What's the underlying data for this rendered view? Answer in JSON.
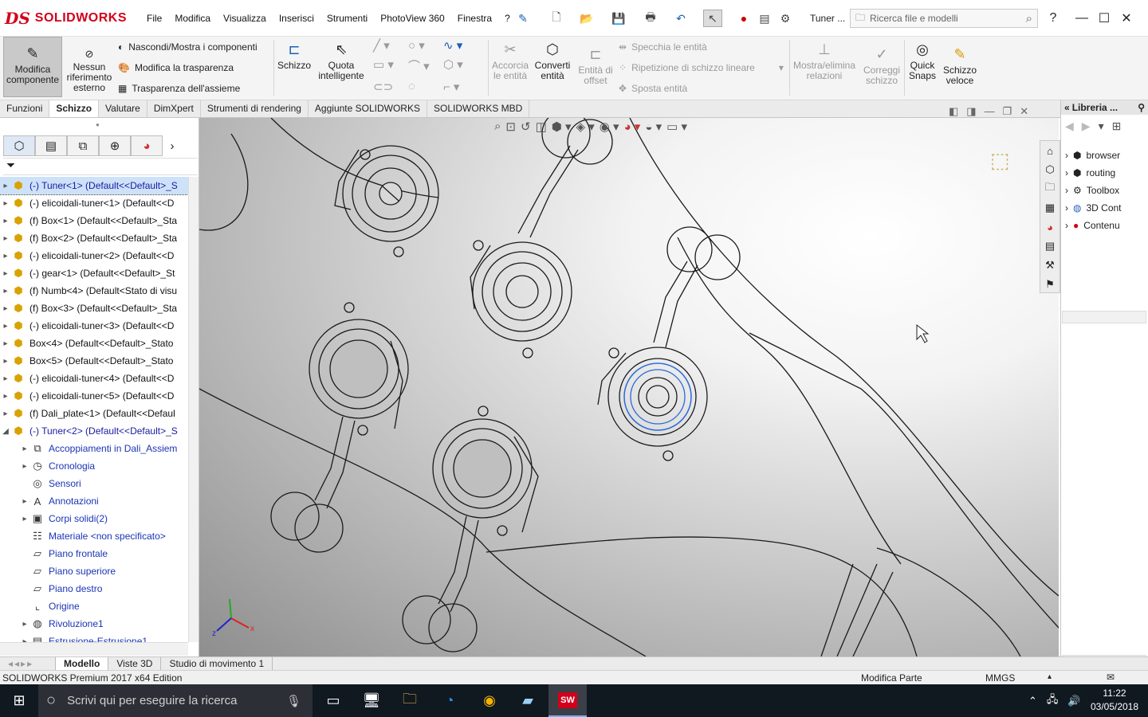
{
  "app": {
    "logo_prefix": "DS",
    "logo_text": "SOLIDWORKS",
    "document_name": "Tuner ...",
    "search_placeholder": "Ricerca file e modelli",
    "help_label": "?"
  },
  "menu": [
    "File",
    "Modifica",
    "Visualizza",
    "Inserisci",
    "Strumenti",
    "PhotoView 360",
    "Finestra",
    "?"
  ],
  "ribbon": {
    "modifica_componente": "Modifica componente",
    "nessun_riferimento": "Nessun riferimento esterno",
    "nascondi_mostra": "Nascondi/Mostra i componenti",
    "modifica_trasparenza": "Modifica la trasparenza",
    "trasparenza_assieme": "Trasparenza dell'assieme",
    "schizzo": "Schizzo",
    "quota_intelligente": "Quota intelligente",
    "accorcia_entita": "Accorcia le entità",
    "converti_entita": "Converti entità",
    "entita_offset": "Entità di offset",
    "specchia_entita": "Specchia le entità",
    "ripetizione_lineare": "Ripetizione di schizzo lineare",
    "sposta_entita": "Sposta entità",
    "mostra_elimina_relazioni": "Mostra/elimina relazioni",
    "correggi_schizzo": "Correggi schizzo",
    "quick_snaps": "Quick Snaps",
    "schizzo_veloce": "Schizzo veloce"
  },
  "tabs": [
    "Funzioni",
    "Schizzo",
    "Valutare",
    "DimXpert",
    "Strumenti di rendering",
    "Aggiunte SOLIDWORKS",
    "SOLIDWORKS MBD"
  ],
  "active_tab": "Schizzo",
  "tree": [
    {
      "label": "(-) Tuner<1> (Default<<Default>_S",
      "kind": "part",
      "selected": true
    },
    {
      "label": "(-) elicoidali-tuner<1> (Default<<D",
      "kind": "part"
    },
    {
      "label": "(f) Box<1> (Default<<Default>_Sta",
      "kind": "part"
    },
    {
      "label": "(f) Box<2> (Default<<Default>_Sta",
      "kind": "part"
    },
    {
      "label": "(-) elicoidali-tuner<2> (Default<<D",
      "kind": "part"
    },
    {
      "label": "(-) gear<1> (Default<<Default>_St",
      "kind": "part"
    },
    {
      "label": "(f) Numb<4> (Default<Stato di visu",
      "kind": "part-b"
    },
    {
      "label": "(f) Box<3> (Default<<Default>_Sta",
      "kind": "part"
    },
    {
      "label": "(-) elicoidali-tuner<3> (Default<<D",
      "kind": "part"
    },
    {
      "label": "Box<4> (Default<<Default>_Stato",
      "kind": "part"
    },
    {
      "label": "Box<5> (Default<<Default>_Stato",
      "kind": "part"
    },
    {
      "label": "(-) elicoidali-tuner<4> (Default<<D",
      "kind": "part"
    },
    {
      "label": "(-) elicoidali-tuner<5> (Default<<D",
      "kind": "part"
    },
    {
      "label": "(f) Dali_plate<1> (Default<<Defaul",
      "kind": "part"
    },
    {
      "label": "(-) Tuner<2> (Default<<Default>_S",
      "kind": "part-open"
    }
  ],
  "subtree": [
    {
      "label": "Accoppiamenti in Dali_Assiem",
      "icon": "mates-icon",
      "expand": true
    },
    {
      "label": "Cronologia",
      "icon": "history-icon",
      "expand": true
    },
    {
      "label": "Sensori",
      "icon": "sensor-icon",
      "expand": false
    },
    {
      "label": "Annotazioni",
      "icon": "annotation-icon",
      "expand": true
    },
    {
      "label": "Corpi solidi(2)",
      "icon": "solid-bodies-icon",
      "expand": true
    },
    {
      "label": "Materiale <non specificato>",
      "icon": "material-icon",
      "expand": false
    },
    {
      "label": "Piano frontale",
      "icon": "plane-icon",
      "expand": false
    },
    {
      "label": "Piano superiore",
      "icon": "plane-icon",
      "expand": false
    },
    {
      "label": "Piano destro",
      "icon": "plane-icon",
      "expand": false
    },
    {
      "label": "Origine",
      "icon": "origin-icon",
      "expand": false
    },
    {
      "label": "Rivoluzione1",
      "icon": "revolve-icon",
      "expand": true
    },
    {
      "label": "Estrusione-Estrusione1",
      "icon": "extrude-icon",
      "expand": true
    }
  ],
  "library": {
    "title": "Libreria ...",
    "items": [
      "browser",
      "routing",
      "Toolbox",
      "3D Cont",
      "Contenu"
    ]
  },
  "bottom_tabs": [
    "Modello",
    "Viste 3D",
    "Studio di movimento 1"
  ],
  "active_bottom_tab": "Modello",
  "status": {
    "edition": "SOLIDWORKS Premium 2017 x64 Edition",
    "mode": "Modifica Parte",
    "units": "MMGS"
  },
  "taskbar": {
    "search_placeholder": "Scrivi qui per eseguire la ricerca",
    "time": "11:22",
    "date": "03/05/2018"
  },
  "colors": {
    "brand_red": "#d2001a",
    "selection_blue": "#cde2f9",
    "tree_link_blue": "#1a1aa0",
    "taskbar": "#101820"
  }
}
